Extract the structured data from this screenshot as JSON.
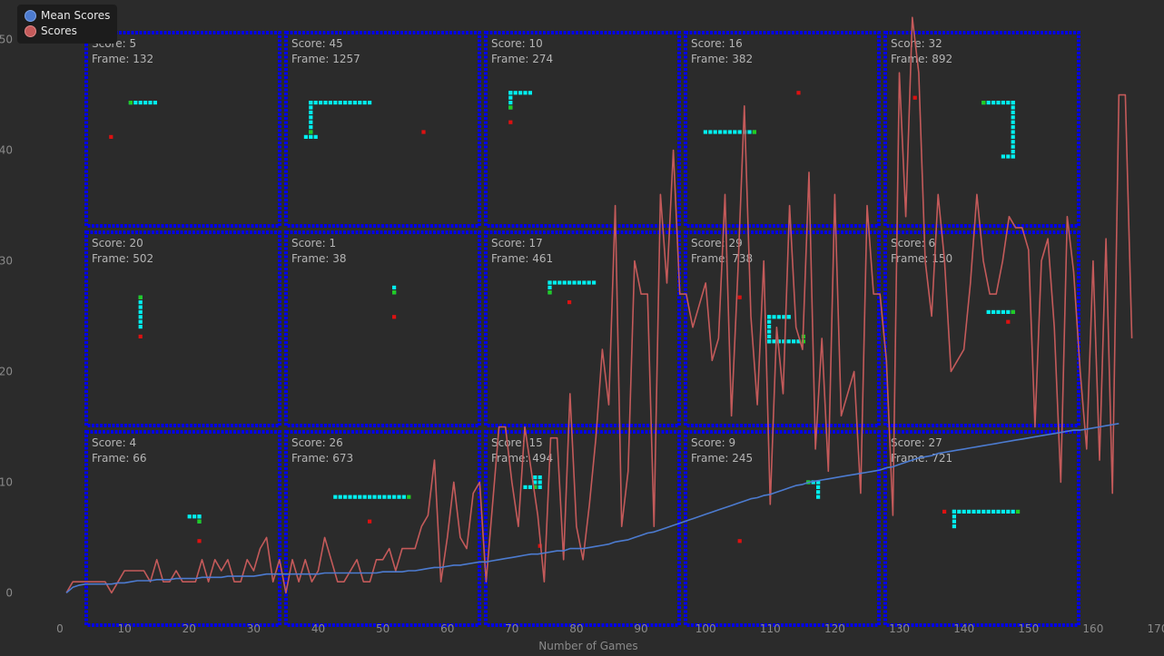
{
  "legend": {
    "mean_label": "Mean Scores",
    "scores_label": "Scores"
  },
  "colors": {
    "background": "#2b2b2b",
    "scores": "#c45a5a",
    "mean": "#4c7bd0",
    "board_border": "#0000ee",
    "snake_body": "#00f0f0",
    "snake_head": "#22cc22",
    "food": "#dd1111"
  },
  "chart_data": {
    "type": "line",
    "xlabel": "Number of Games",
    "ylabel": "",
    "xlim": [
      0,
      170
    ],
    "ylim": [
      -3,
      53
    ],
    "xticks": [
      0,
      10,
      20,
      30,
      40,
      50,
      60,
      70,
      80,
      90,
      100,
      110,
      120,
      130,
      140,
      150,
      160,
      170
    ],
    "yticks": [
      0,
      10,
      20,
      30,
      40,
      50
    ],
    "series": [
      {
        "name": "Scores",
        "color": "#c45a5a",
        "values": [
          0,
          1,
          1,
          1,
          1,
          1,
          1,
          0,
          1,
          2,
          2,
          2,
          2,
          1,
          3,
          1,
          1,
          2,
          1,
          1,
          1,
          3,
          1,
          3,
          2,
          3,
          1,
          1,
          3,
          2,
          4,
          5,
          1,
          3,
          0,
          3,
          1,
          3,
          1,
          2,
          5,
          3,
          1,
          1,
          2,
          3,
          1,
          1,
          3,
          3,
          4,
          2,
          4,
          4,
          4,
          6,
          7,
          12,
          1,
          5,
          10,
          5,
          4,
          9,
          10,
          1,
          8,
          15,
          15,
          10,
          6,
          15,
          11,
          7,
          1,
          14,
          14,
          3,
          18,
          6,
          3,
          8,
          14,
          22,
          17,
          35,
          6,
          11,
          30,
          27,
          27,
          6,
          36,
          28,
          40,
          27,
          27,
          24,
          26,
          28,
          21,
          23,
          36,
          16,
          29,
          44,
          25,
          17,
          30,
          8,
          24,
          18,
          35,
          24,
          22,
          38,
          13,
          23,
          11,
          36,
          16,
          18,
          20,
          9,
          35,
          27,
          27,
          21,
          7,
          47,
          34,
          52,
          47,
          30,
          25,
          36,
          30,
          20,
          21,
          22,
          28,
          36,
          30,
          27,
          27,
          30,
          34,
          33,
          33,
          31,
          15,
          30,
          32,
          24,
          10,
          34,
          29,
          20,
          13,
          30,
          12,
          32,
          9,
          45,
          45,
          23
        ]
      },
      {
        "name": "Mean Scores",
        "color": "#4c7bd0",
        "values": [
          0,
          0.5,
          0.7,
          0.8,
          0.8,
          0.8,
          0.8,
          0.8,
          0.9,
          0.9,
          1.0,
          1.1,
          1.1,
          1.1,
          1.2,
          1.2,
          1.2,
          1.3,
          1.3,
          1.3,
          1.3,
          1.4,
          1.4,
          1.4,
          1.4,
          1.5,
          1.5,
          1.5,
          1.5,
          1.5,
          1.6,
          1.7,
          1.7,
          1.7,
          1.7,
          1.7,
          1.7,
          1.7,
          1.7,
          1.7,
          1.8,
          1.8,
          1.8,
          1.8,
          1.8,
          1.8,
          1.8,
          1.8,
          1.8,
          1.9,
          1.9,
          1.9,
          1.9,
          2.0,
          2.0,
          2.1,
          2.2,
          2.3,
          2.3,
          2.4,
          2.5,
          2.5,
          2.6,
          2.7,
          2.8,
          2.8,
          2.9,
          3.0,
          3.1,
          3.2,
          3.3,
          3.4,
          3.5,
          3.5,
          3.6,
          3.7,
          3.8,
          3.8,
          4.0,
          4.0,
          4.0,
          4.1,
          4.2,
          4.3,
          4.4,
          4.6,
          4.7,
          4.8,
          5.0,
          5.2,
          5.4,
          5.5,
          5.7,
          5.9,
          6.1,
          6.3,
          6.5,
          6.7,
          6.9,
          7.1,
          7.3,
          7.5,
          7.7,
          7.9,
          8.1,
          8.3,
          8.5,
          8.6,
          8.8,
          8.9,
          9.1,
          9.3,
          9.5,
          9.7,
          9.8,
          10.0,
          10.1,
          10.2,
          10.3,
          10.4,
          10.5,
          10.6,
          10.7,
          10.8,
          10.9,
          11.0,
          11.1,
          11.3,
          11.4,
          11.6,
          11.8,
          12.0,
          12.2,
          12.3,
          12.4,
          12.6,
          12.7,
          12.8,
          12.9,
          13.0,
          13.1,
          13.2,
          13.3,
          13.4,
          13.5,
          13.6,
          13.7,
          13.8,
          13.9,
          14.0,
          14.1,
          14.2,
          14.3,
          14.4,
          14.5,
          14.6,
          14.7,
          14.7,
          14.8,
          14.9,
          15.0,
          15.1,
          15.2,
          15.3
        ]
      }
    ]
  },
  "boards": [
    {
      "score_label": "Score: 5",
      "frame_label": "Frame: 132",
      "snake": [
        [
          7,
          5,
          6,
          1
        ]
      ],
      "head": [
        [
          7,
          5,
          1,
          1
        ]
      ],
      "food": [
        [
          3,
          12
        ]
      ]
    },
    {
      "score_label": "Score: 45",
      "frame_label": "Frame: 1257",
      "snake": [
        [
          2,
          12,
          3,
          1
        ],
        [
          3,
          5,
          1,
          8
        ],
        [
          3,
          5,
          13,
          1
        ]
      ],
      "head": [
        [
          3,
          11,
          1,
          1
        ]
      ],
      "food": [
        [
          26,
          11
        ]
      ]
    },
    {
      "score_label": "Score: 10",
      "frame_label": "Frame: 274",
      "snake": [
        [
          3,
          3,
          5,
          1
        ],
        [
          3,
          3,
          1,
          4
        ]
      ],
      "head": [
        [
          3,
          6,
          1,
          1
        ]
      ],
      "food": [
        [
          3,
          9
        ]
      ]
    },
    {
      "score_label": "Score: 16",
      "frame_label": "Frame: 382",
      "snake": [
        [
          2,
          11,
          11,
          1
        ]
      ],
      "head": [
        [
          12,
          11,
          1,
          1
        ]
      ],
      "food": [
        [
          21,
          3
        ]
      ]
    },
    {
      "score_label": "Score: 32",
      "frame_label": "Frame: 892",
      "snake": [
        [
          18,
          5,
          7,
          1
        ],
        [
          24,
          5,
          1,
          12
        ],
        [
          22,
          16,
          3,
          1
        ]
      ],
      "head": [
        [
          18,
          5,
          1,
          1
        ]
      ],
      "food": [
        [
          4,
          4
        ]
      ]
    },
    {
      "score_label": "Score: 20",
      "frame_label": "Frame: 502",
      "snake": [
        [
          9,
          4,
          1,
          7
        ]
      ],
      "head": [
        [
          9,
          4,
          1,
          1
        ]
      ],
      "food": [
        [
          9,
          12
        ]
      ]
    },
    {
      "score_label": "Score: 1",
      "frame_label": "Frame: 38",
      "snake": [
        [
          20,
          2,
          1,
          2
        ]
      ],
      "head": [
        [
          20,
          3,
          1,
          1
        ]
      ],
      "food": [
        [
          20,
          8
        ]
      ]
    },
    {
      "score_label": "Score: 17",
      "frame_label": "Frame: 461",
      "snake": [
        [
          11,
          1,
          10,
          1
        ],
        [
          11,
          1,
          1,
          3
        ]
      ],
      "head": [
        [
          11,
          3,
          1,
          1
        ]
      ],
      "food": [
        [
          15,
          5
        ]
      ]
    },
    {
      "score_label": "Score: 29",
      "frame_label": "Frame: 738",
      "snake": [
        [
          15,
          8,
          5,
          1
        ],
        [
          15,
          8,
          1,
          6
        ],
        [
          15,
          13,
          7,
          1
        ],
        [
          19,
          8,
          1,
          1
        ]
      ],
      "head": [
        [
          22,
          12,
          1,
          2
        ]
      ],
      "food": [
        [
          9,
          4
        ]
      ]
    },
    {
      "score_label": "Score: 6",
      "frame_label": "Frame: 150",
      "snake": [
        [
          19,
          7,
          6,
          1
        ]
      ],
      "head": [
        [
          24,
          7,
          1,
          1
        ]
      ],
      "food": [
        [
          23,
          9
        ]
      ]
    },
    {
      "score_label": "Score: 4",
      "frame_label": "Frame: 66",
      "snake": [
        [
          19,
          8,
          3,
          1
        ],
        [
          21,
          8,
          1,
          2
        ]
      ],
      "head": [
        [
          21,
          9,
          1,
          1
        ]
      ],
      "food": [
        [
          21,
          13
        ]
      ]
    },
    {
      "score_label": "Score: 26",
      "frame_label": "Frame: 673",
      "snake": [
        [
          8,
          4,
          15,
          1
        ]
      ],
      "head": [
        [
          23,
          4,
          1,
          1
        ]
      ],
      "food": [
        [
          15,
          9
        ]
      ]
    },
    {
      "score_label": "Score: 15",
      "frame_label": "Frame: 494",
      "snake": [
        [
          6,
          2,
          3,
          1
        ],
        [
          8,
          0,
          2,
          3
        ]
      ],
      "head": [
        [
          8,
          2,
          1,
          1
        ]
      ],
      "food": [
        [
          9,
          14
        ]
      ]
    },
    {
      "score_label": "Score: 9",
      "frame_label": "Frame: 245",
      "snake": [
        [
          23,
          1,
          3,
          1
        ],
        [
          25,
          1,
          1,
          4
        ]
      ],
      "head": [
        [
          23,
          1,
          1,
          1
        ]
      ],
      "food": [
        [
          9,
          13
        ]
      ]
    },
    {
      "score_label": "Score: 27",
      "frame_label": "Frame: 721",
      "snake": [
        [
          12,
          7,
          13,
          1
        ],
        [
          12,
          7,
          1,
          4
        ]
      ],
      "head": [
        [
          25,
          7,
          1,
          1
        ]
      ],
      "food": [
        [
          10,
          7
        ]
      ]
    }
  ]
}
